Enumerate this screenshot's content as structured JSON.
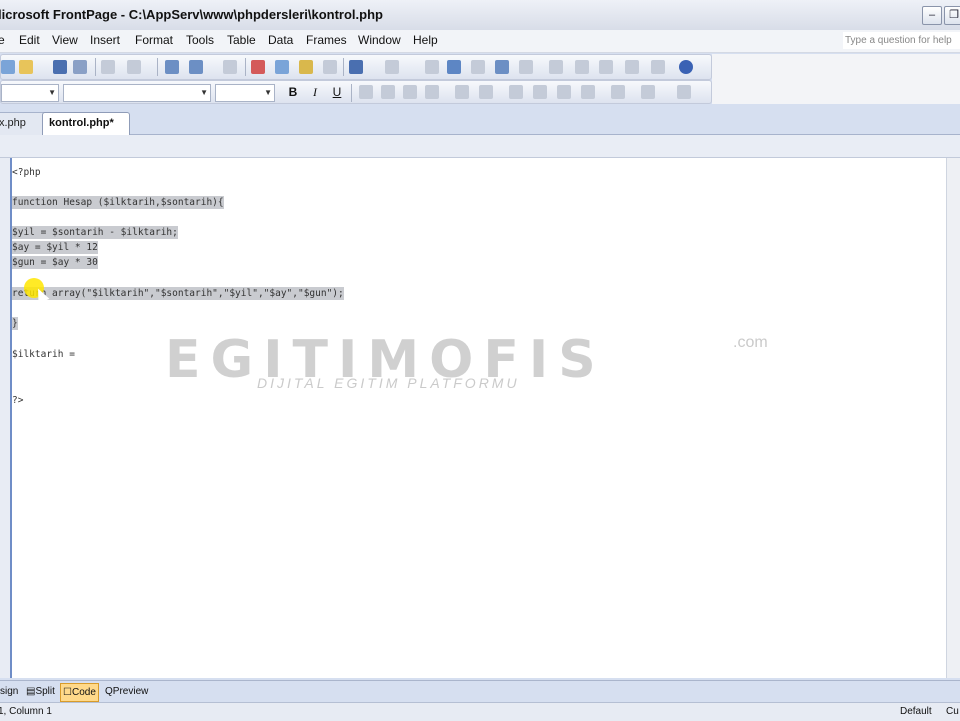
{
  "window": {
    "title": "licrosoft FrontPage - C:\\AppServ\\www\\phpdersleri\\kontrol.php",
    "minimize": "–",
    "restore": "❐"
  },
  "menu": [
    "e",
    "Edit",
    "View",
    "Insert",
    "Format",
    "Tools",
    "Table",
    "Data",
    "Frames",
    "Window",
    "Help"
  ],
  "help_box_placeholder": "Type a question for help",
  "tabs": [
    "x.php",
    "kontrol.php*"
  ],
  "code_lines": [
    "<?php",
    "",
    "function Hesap ($ilktarih,$sontarih){",
    "",
    "$yil = $sontarih - $ilktarih;",
    "$ay = $yil * 12",
    "$gun = $ay * 30",
    "",
    "return array(\"$ilktarih\",\"$sontarih\",\"$yil\",\"$ay\",\"$gun\");",
    "",
    "}",
    "",
    "",
    "$ilktarih =",
    "",
    "",
    "?>"
  ],
  "watermark": {
    "brand": "EGITIMOFIS",
    "tld": ".com",
    "tagline": "DIJITAL EGITIM PLATFORMU"
  },
  "view_tabs": [
    "sign",
    "Split",
    "Code",
    "Preview"
  ],
  "status": {
    "position": "1, Column 1",
    "mode": "Default",
    "extra": "Cu"
  }
}
